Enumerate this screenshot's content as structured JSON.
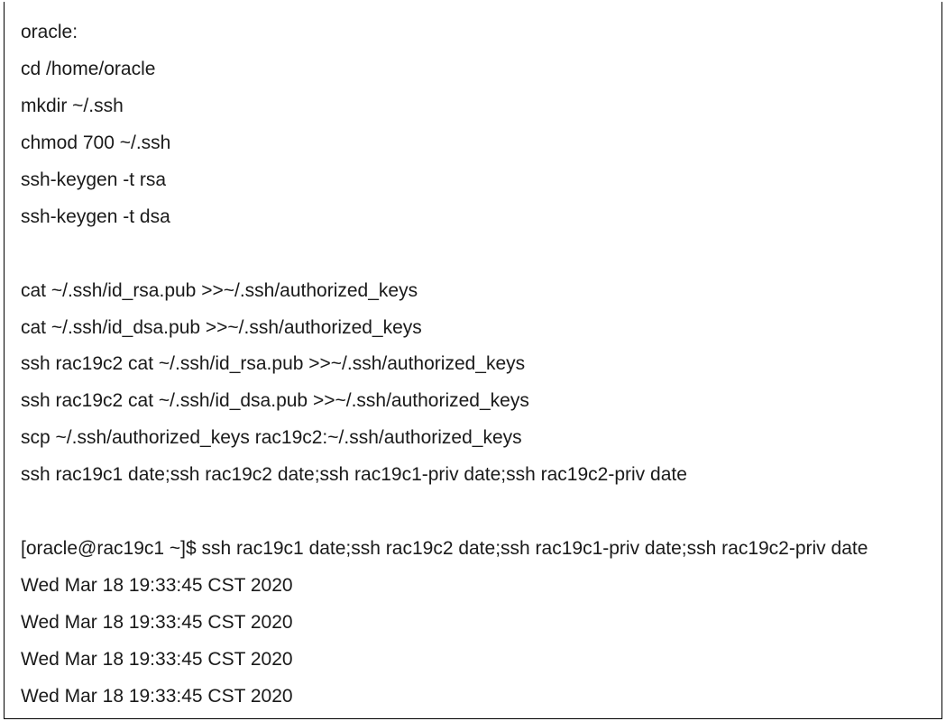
{
  "lines": [
    "oracle:",
    "cd /home/oracle",
    "mkdir ~/.ssh",
    "chmod 700 ~/.ssh",
    "ssh-keygen -t rsa",
    "ssh-keygen -t dsa",
    "",
    "cat ~/.ssh/id_rsa.pub >>~/.ssh/authorized_keys",
    "cat ~/.ssh/id_dsa.pub >>~/.ssh/authorized_keys",
    "ssh rac19c2 cat ~/.ssh/id_rsa.pub >>~/.ssh/authorized_keys",
    "ssh rac19c2 cat ~/.ssh/id_dsa.pub >>~/.ssh/authorized_keys",
    "scp ~/.ssh/authorized_keys rac19c2:~/.ssh/authorized_keys",
    "ssh rac19c1 date;ssh rac19c2 date;ssh rac19c1-priv date;ssh rac19c2-priv date",
    "",
    "[oracle@rac19c1 ~]$ ssh rac19c1 date;ssh rac19c2 date;ssh rac19c1-priv date;ssh rac19c2-priv date",
    "Wed Mar 18 19:33:45 CST 2020",
    "Wed Mar 18 19:33:45 CST 2020",
    "Wed Mar 18 19:33:45 CST 2020",
    "Wed Mar 18 19:33:45 CST 2020"
  ]
}
